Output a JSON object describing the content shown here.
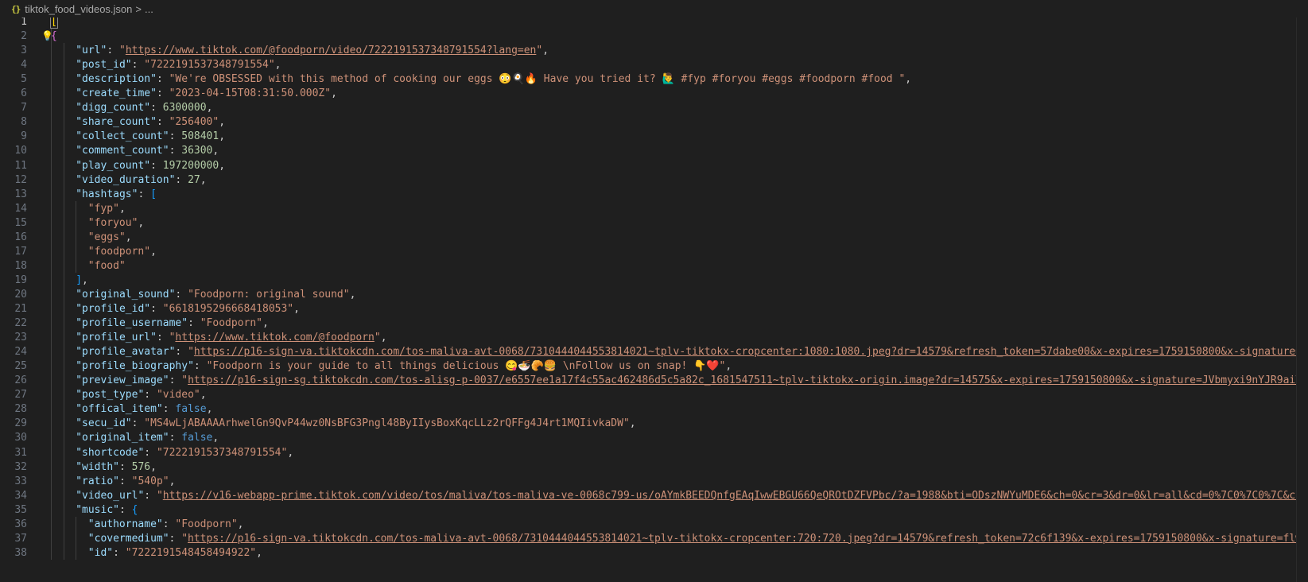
{
  "breadcrumb": {
    "icon": "{}",
    "filename": "tiktok_food_videos.json",
    "separator": ">",
    "ellipsis": "..."
  },
  "colors": {
    "background": "#1f1f1f",
    "key": "#9cdcfe",
    "string": "#ce9178",
    "number": "#b5cea8",
    "boolean": "#569cd6",
    "bracket_level1": "#ffd700",
    "bracket_level2": "#da70d6",
    "bracket_level3": "#179fff"
  },
  "lines": [
    {
      "num": "1",
      "indent": 0,
      "tokens": [
        {
          "t": "[",
          "c": "br1 cursor-box"
        }
      ]
    },
    {
      "num": "2",
      "indent": 0,
      "bulb": true,
      "tokens": [
        {
          "t": "{",
          "c": "br2"
        }
      ]
    },
    {
      "num": "3",
      "indent": 4,
      "tokens": [
        {
          "t": "\"url\"",
          "c": "k"
        },
        {
          "t": ": ",
          "c": "p"
        },
        {
          "t": "\"",
          "c": "s"
        },
        {
          "t": "https://www.tiktok.com/@foodporn/video/7222191537348791554?lang=en",
          "c": "s u"
        },
        {
          "t": "\"",
          "c": "s"
        },
        {
          "t": ",",
          "c": "p"
        }
      ]
    },
    {
      "num": "4",
      "indent": 4,
      "tokens": [
        {
          "t": "\"post_id\"",
          "c": "k"
        },
        {
          "t": ": ",
          "c": "p"
        },
        {
          "t": "\"7222191537348791554\"",
          "c": "s"
        },
        {
          "t": ",",
          "c": "p"
        }
      ]
    },
    {
      "num": "5",
      "indent": 4,
      "tokens": [
        {
          "t": "\"description\"",
          "c": "k"
        },
        {
          "t": ": ",
          "c": "p"
        },
        {
          "t": "\"We're OBSESSED with this method of cooking our eggs 😳🍳🔥 Have you tried it? 🙋‍♂️ #fyp #foryou #eggs #foodporn #food \"",
          "c": "s"
        },
        {
          "t": ",",
          "c": "p"
        }
      ]
    },
    {
      "num": "6",
      "indent": 4,
      "tokens": [
        {
          "t": "\"create_time\"",
          "c": "k"
        },
        {
          "t": ": ",
          "c": "p"
        },
        {
          "t": "\"2023-04-15T08:31:50.000Z\"",
          "c": "s"
        },
        {
          "t": ",",
          "c": "p"
        }
      ]
    },
    {
      "num": "7",
      "indent": 4,
      "tokens": [
        {
          "t": "\"digg_count\"",
          "c": "k"
        },
        {
          "t": ": ",
          "c": "p"
        },
        {
          "t": "6300000",
          "c": "n"
        },
        {
          "t": ",",
          "c": "p"
        }
      ]
    },
    {
      "num": "8",
      "indent": 4,
      "tokens": [
        {
          "t": "\"share_count\"",
          "c": "k"
        },
        {
          "t": ": ",
          "c": "p"
        },
        {
          "t": "\"256400\"",
          "c": "s"
        },
        {
          "t": ",",
          "c": "p"
        }
      ]
    },
    {
      "num": "9",
      "indent": 4,
      "tokens": [
        {
          "t": "\"collect_count\"",
          "c": "k"
        },
        {
          "t": ": ",
          "c": "p"
        },
        {
          "t": "508401",
          "c": "n"
        },
        {
          "t": ",",
          "c": "p"
        }
      ]
    },
    {
      "num": "10",
      "indent": 4,
      "tokens": [
        {
          "t": "\"comment_count\"",
          "c": "k"
        },
        {
          "t": ": ",
          "c": "p"
        },
        {
          "t": "36300",
          "c": "n"
        },
        {
          "t": ",",
          "c": "p"
        }
      ]
    },
    {
      "num": "11",
      "indent": 4,
      "tokens": [
        {
          "t": "\"play_count\"",
          "c": "k"
        },
        {
          "t": ": ",
          "c": "p"
        },
        {
          "t": "197200000",
          "c": "n"
        },
        {
          "t": ",",
          "c": "p"
        }
      ]
    },
    {
      "num": "12",
      "indent": 4,
      "tokens": [
        {
          "t": "\"video_duration\"",
          "c": "k"
        },
        {
          "t": ": ",
          "c": "p"
        },
        {
          "t": "27",
          "c": "n"
        },
        {
          "t": ",",
          "c": "p"
        }
      ]
    },
    {
      "num": "13",
      "indent": 4,
      "tokens": [
        {
          "t": "\"hashtags\"",
          "c": "k"
        },
        {
          "t": ": ",
          "c": "p"
        },
        {
          "t": "[",
          "c": "br3"
        }
      ]
    },
    {
      "num": "14",
      "indent": 6,
      "tokens": [
        {
          "t": "\"fyp\"",
          "c": "s"
        },
        {
          "t": ",",
          "c": "p"
        }
      ]
    },
    {
      "num": "15",
      "indent": 6,
      "tokens": [
        {
          "t": "\"foryou\"",
          "c": "s"
        },
        {
          "t": ",",
          "c": "p"
        }
      ]
    },
    {
      "num": "16",
      "indent": 6,
      "tokens": [
        {
          "t": "\"eggs\"",
          "c": "s"
        },
        {
          "t": ",",
          "c": "p"
        }
      ]
    },
    {
      "num": "17",
      "indent": 6,
      "tokens": [
        {
          "t": "\"foodporn\"",
          "c": "s"
        },
        {
          "t": ",",
          "c": "p"
        }
      ]
    },
    {
      "num": "18",
      "indent": 6,
      "tokens": [
        {
          "t": "\"food\"",
          "c": "s"
        }
      ]
    },
    {
      "num": "19",
      "indent": 4,
      "tokens": [
        {
          "t": "]",
          "c": "br3"
        },
        {
          "t": ",",
          "c": "p"
        }
      ]
    },
    {
      "num": "20",
      "indent": 4,
      "tokens": [
        {
          "t": "\"original_sound\"",
          "c": "k"
        },
        {
          "t": ": ",
          "c": "p"
        },
        {
          "t": "\"Foodporn: original sound\"",
          "c": "s"
        },
        {
          "t": ",",
          "c": "p"
        }
      ]
    },
    {
      "num": "21",
      "indent": 4,
      "tokens": [
        {
          "t": "\"profile_id\"",
          "c": "k"
        },
        {
          "t": ": ",
          "c": "p"
        },
        {
          "t": "\"6618195296668418053\"",
          "c": "s"
        },
        {
          "t": ",",
          "c": "p"
        }
      ]
    },
    {
      "num": "22",
      "indent": 4,
      "tokens": [
        {
          "t": "\"profile_username\"",
          "c": "k"
        },
        {
          "t": ": ",
          "c": "p"
        },
        {
          "t": "\"Foodporn\"",
          "c": "s"
        },
        {
          "t": ",",
          "c": "p"
        }
      ]
    },
    {
      "num": "23",
      "indent": 4,
      "tokens": [
        {
          "t": "\"profile_url\"",
          "c": "k"
        },
        {
          "t": ": ",
          "c": "p"
        },
        {
          "t": "\"",
          "c": "s"
        },
        {
          "t": "https://www.tiktok.com/@foodporn",
          "c": "s u"
        },
        {
          "t": "\"",
          "c": "s"
        },
        {
          "t": ",",
          "c": "p"
        }
      ]
    },
    {
      "num": "24",
      "indent": 4,
      "tokens": [
        {
          "t": "\"profile_avatar\"",
          "c": "k"
        },
        {
          "t": ": ",
          "c": "p"
        },
        {
          "t": "\"",
          "c": "s"
        },
        {
          "t": "https://p16-sign-va.tiktokcdn.com/tos-maliva-avt-0068/7310444044553814021~tplv-tiktokx-cropcenter:1080:1080.jpeg?dr=14579&refresh_token=57dabe00&x-expires=1759150800&x-signature=CPJ",
          "c": "s u"
        }
      ]
    },
    {
      "num": "25",
      "indent": 4,
      "tokens": [
        {
          "t": "\"profile_biography\"",
          "c": "k"
        },
        {
          "t": ": ",
          "c": "p"
        },
        {
          "t": "\"Foodporn is your guide to all things delicious 😋🍜🥐🍔 \\nFollow us on snap! 👇❤️\"",
          "c": "s"
        },
        {
          "t": ",",
          "c": "p"
        }
      ]
    },
    {
      "num": "26",
      "indent": 4,
      "tokens": [
        {
          "t": "\"preview_image\"",
          "c": "k"
        },
        {
          "t": ": ",
          "c": "p"
        },
        {
          "t": "\"",
          "c": "s"
        },
        {
          "t": "https://p16-sign-sg.tiktokcdn.com/tos-alisg-p-0037/e6557ee1a17f4c55ac462486d5c5a82c_1681547511~tplv-tiktokx-origin.image?dr=14575&x-expires=1759150800&x-signature=JVbmyxi9nYJR9aiVf0r",
          "c": "s u"
        }
      ]
    },
    {
      "num": "27",
      "indent": 4,
      "tokens": [
        {
          "t": "\"post_type\"",
          "c": "k"
        },
        {
          "t": ": ",
          "c": "p"
        },
        {
          "t": "\"video\"",
          "c": "s"
        },
        {
          "t": ",",
          "c": "p"
        }
      ]
    },
    {
      "num": "28",
      "indent": 4,
      "tokens": [
        {
          "t": "\"offical_item\"",
          "c": "k"
        },
        {
          "t": ": ",
          "c": "p"
        },
        {
          "t": "false",
          "c": "b"
        },
        {
          "t": ",",
          "c": "p"
        }
      ]
    },
    {
      "num": "29",
      "indent": 4,
      "tokens": [
        {
          "t": "\"secu_id\"",
          "c": "k"
        },
        {
          "t": ": ",
          "c": "p"
        },
        {
          "t": "\"MS4wLjABAAAArhwelGn9QvP44wz0NsBFG3Pngl48ByIIysBoxKqcLLz2rQFFg4J4rt1MQIivkaDW\"",
          "c": "s"
        },
        {
          "t": ",",
          "c": "p"
        }
      ]
    },
    {
      "num": "30",
      "indent": 4,
      "tokens": [
        {
          "t": "\"original_item\"",
          "c": "k"
        },
        {
          "t": ": ",
          "c": "p"
        },
        {
          "t": "false",
          "c": "b"
        },
        {
          "t": ",",
          "c": "p"
        }
      ]
    },
    {
      "num": "31",
      "indent": 4,
      "tokens": [
        {
          "t": "\"shortcode\"",
          "c": "k"
        },
        {
          "t": ": ",
          "c": "p"
        },
        {
          "t": "\"7222191537348791554\"",
          "c": "s"
        },
        {
          "t": ",",
          "c": "p"
        }
      ]
    },
    {
      "num": "32",
      "indent": 4,
      "tokens": [
        {
          "t": "\"width\"",
          "c": "k"
        },
        {
          "t": ": ",
          "c": "p"
        },
        {
          "t": "576",
          "c": "n"
        },
        {
          "t": ",",
          "c": "p"
        }
      ]
    },
    {
      "num": "33",
      "indent": 4,
      "tokens": [
        {
          "t": "\"ratio\"",
          "c": "k"
        },
        {
          "t": ": ",
          "c": "p"
        },
        {
          "t": "\"540p\"",
          "c": "s"
        },
        {
          "t": ",",
          "c": "p"
        }
      ]
    },
    {
      "num": "34",
      "indent": 4,
      "tokens": [
        {
          "t": "\"video_url\"",
          "c": "k"
        },
        {
          "t": ": ",
          "c": "p"
        },
        {
          "t": "\"",
          "c": "s"
        },
        {
          "t": "https://v16-webapp-prime.tiktok.com/video/tos/maliva/tos-maliva-ve-0068c799-us/oAYmkBEEDQnfgEAqIwwEBGU66QeQROtDZFVPbc/?a=1988&bti=ODszNWYuMDE6&ch=0&cr=3&dr=0&lr=all&cd=0%7C0%7C0%7C&cv=1&",
          "c": "s u"
        }
      ]
    },
    {
      "num": "35",
      "indent": 4,
      "tokens": [
        {
          "t": "\"music\"",
          "c": "k"
        },
        {
          "t": ": ",
          "c": "p"
        },
        {
          "t": "{",
          "c": "br3"
        }
      ]
    },
    {
      "num": "36",
      "indent": 6,
      "tokens": [
        {
          "t": "\"authorname\"",
          "c": "k"
        },
        {
          "t": ": ",
          "c": "p"
        },
        {
          "t": "\"Foodporn\"",
          "c": "s"
        },
        {
          "t": ",",
          "c": "p"
        }
      ]
    },
    {
      "num": "37",
      "indent": 6,
      "tokens": [
        {
          "t": "\"covermedium\"",
          "c": "k"
        },
        {
          "t": ": ",
          "c": "p"
        },
        {
          "t": "\"",
          "c": "s"
        },
        {
          "t": "https://p16-sign-va.tiktokcdn.com/tos-maliva-avt-0068/7310444044553814021~tplv-tiktokx-cropcenter:720:720.jpeg?dr=14579&refresh_token=72c6f139&x-expires=1759150800&x-signature=flw53M",
          "c": "s u"
        }
      ]
    },
    {
      "num": "38",
      "indent": 6,
      "tokens": [
        {
          "t": "\"id\"",
          "c": "k"
        },
        {
          "t": ": ",
          "c": "p"
        },
        {
          "t": "\"7222191548458494922\"",
          "c": "s"
        },
        {
          "t": ",",
          "c": "p"
        }
      ]
    }
  ]
}
